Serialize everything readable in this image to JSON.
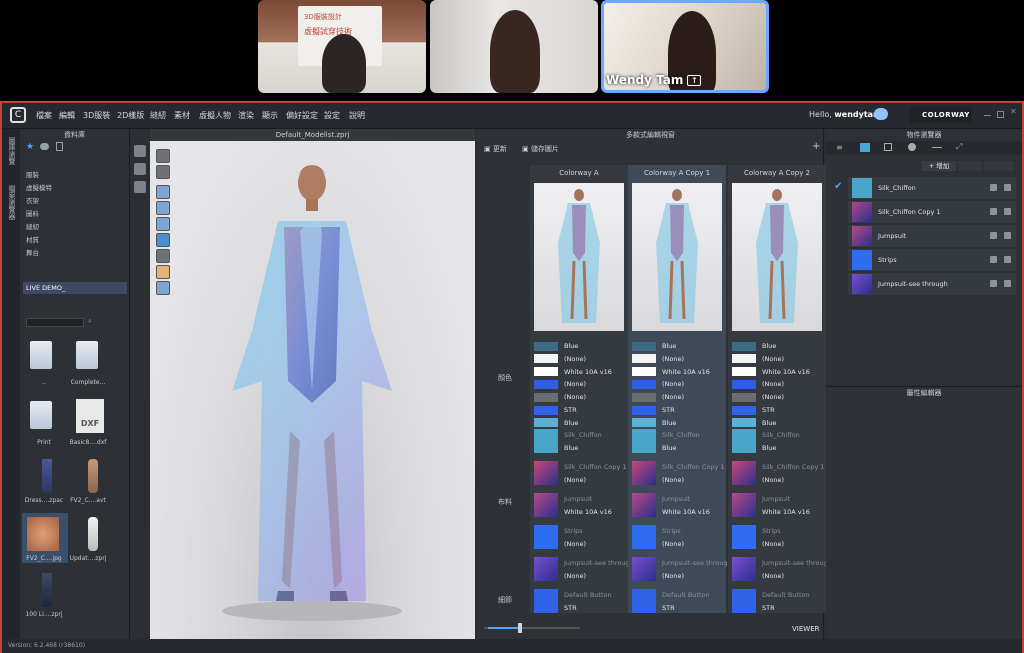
{
  "meeting": {
    "participants": [
      {
        "name": "",
        "poster_line1": "3D服裝設計",
        "poster_line2": "虛擬試穿技術"
      },
      {
        "name": ""
      },
      {
        "name": "Wendy Tam"
      }
    ]
  },
  "app": {
    "menu": [
      "檔案",
      "編輯",
      "3D服裝",
      "2D樣版",
      "縫紉",
      "素材",
      "虛擬人物",
      "渲染",
      "顯示",
      "偏好設定",
      "設定",
      "說明"
    ],
    "hello_prefix": "Hello,",
    "username": "wendytam",
    "colorway_button": "COLORWAY",
    "version": "Version: 6.2.468 (r38610)"
  },
  "sidetabs": [
    "圖庫瀏覽",
    "檔案瀏覽器"
  ],
  "library": {
    "title": "資料庫",
    "tree": [
      "服裝",
      "虛擬模特",
      "衣架",
      "圖料",
      "縫紉",
      "材質",
      "舞台",
      "LIVE DEMO_"
    ],
    "files": [
      {
        "label": "..",
        "kind": "folder"
      },
      {
        "label": "Complete...",
        "kind": "folder"
      },
      {
        "label": "Print",
        "kind": "folder"
      },
      {
        "label": "Basic8....dxf",
        "kind": "dxf",
        "badge": "DXF"
      },
      {
        "label": "Dress....zpac",
        "kind": "dress"
      },
      {
        "label": "FV2_C....avt",
        "kind": "avatar"
      },
      {
        "label": "FV2_C....jpg",
        "kind": "texture"
      },
      {
        "label": "Updat....zprj",
        "kind": "avatar"
      },
      {
        "label": "100 Li....zprj",
        "kind": "dress"
      }
    ]
  },
  "viewport": {
    "title": "Default_Modelist.zprj"
  },
  "colorway": {
    "title": "多款式編輯視窗",
    "toolbar": [
      "更新",
      "儲存圖片"
    ],
    "columns": [
      "Colorway A",
      "Colorway A Copy 1",
      "Colorway A Copy 2"
    ],
    "row_labels": {
      "color": "顏色",
      "fabric": "布料",
      "detail": "細節"
    },
    "colors": [
      {
        "hex": "#3d6b86",
        "label": "Blue"
      },
      {
        "hex": "#f4f4f4",
        "label": "(None)"
      },
      {
        "hex": "#ffffff",
        "label": "White 10A v16"
      },
      {
        "hex": "#2e5fe0",
        "label": "(None)"
      },
      {
        "hex": "#6a6d72",
        "label": "(None)"
      },
      {
        "hex": "#2f63e8",
        "label": "STR"
      },
      {
        "hex": "#5ab0d6",
        "label": "Blue"
      }
    ],
    "fabrics": [
      {
        "name": "Silk_Chiffon",
        "value": "Blue",
        "swatch": "#4aa6c8"
      },
      {
        "name": "Silk_Chiffon Copy 1",
        "value": "(None)",
        "swatch": "#c9487a"
      },
      {
        "name": "Jumpsuit",
        "value": "White 10A v16",
        "swatch": "#b84a86"
      },
      {
        "name": "Strips",
        "value": "(None)",
        "swatch": "#2e6cf0"
      },
      {
        "name": "Jumpsuit-see through",
        "value": "(None)",
        "swatch": "#7a4fd0"
      },
      {
        "name": "Default Button",
        "value": "STR",
        "swatch": "#2f63e8"
      }
    ],
    "viewer_label": "VIEWER"
  },
  "object_browser": {
    "title": "物件瀏覽器",
    "add_label": "+ 增加",
    "items": [
      {
        "name": "Silk_Chiffon",
        "swatch": "#4aa6c8",
        "checked": true
      },
      {
        "name": "Silk_Chiffon Copy 1",
        "swatch": "#b0478a",
        "checked": false
      },
      {
        "name": "Jumpsuit",
        "swatch": "#b84a86",
        "checked": false
      },
      {
        "name": "Strips",
        "swatch": "#2e6cf0",
        "checked": false
      },
      {
        "name": "Jumpsuit-see through",
        "swatch": "#7a4fd0",
        "checked": false
      }
    ]
  },
  "property_editor": {
    "title": "屬性編輯器"
  }
}
